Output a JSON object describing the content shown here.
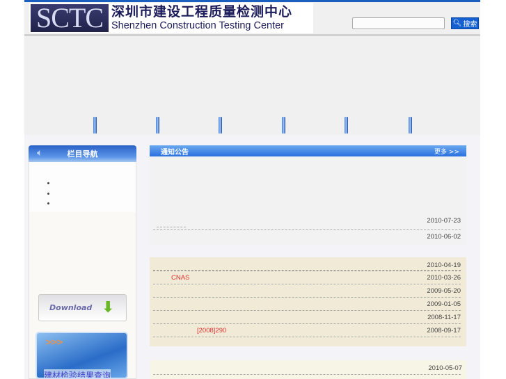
{
  "header": {
    "logo_mark": "SCTC",
    "logo_cn": "深圳市建设工程质量检测中心",
    "logo_en": "Shenzhen Construction Testing Center",
    "search_placeholder": "",
    "search_button": "搜索"
  },
  "sidebar": {
    "title": "栏目导航",
    "download": "Download",
    "banner_text": "建材检验结果查询"
  },
  "notice": {
    "title": "通知公告",
    "more": "更多 >>",
    "dates": [
      "2010-07-23",
      "2010-06-02"
    ]
  },
  "panel2": {
    "items": [
      {
        "text": "",
        "date": "2010-04-19"
      },
      {
        "text": "CNAS",
        "date": "2010-03-26"
      },
      {
        "text": "",
        "date": "2009-05-20"
      },
      {
        "text": "",
        "date": "2009-01-05"
      },
      {
        "text": "",
        "date": "2008-11-17"
      },
      {
        "text": "[2008]290",
        "date": "2008-09-17"
      }
    ]
  },
  "panel3": {
    "dates": [
      "2010-05-07"
    ]
  }
}
